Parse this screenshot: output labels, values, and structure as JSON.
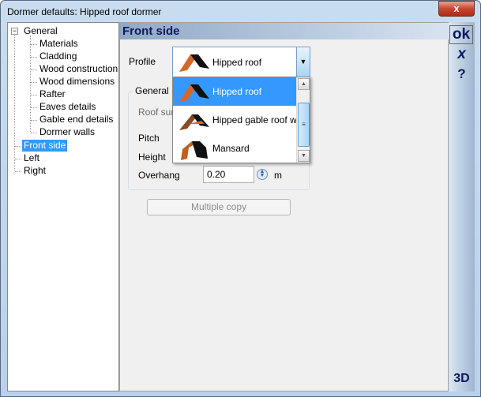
{
  "window": {
    "title": "Dormer defaults: Hipped roof dormer",
    "close": "x"
  },
  "tree": {
    "items": [
      {
        "label": "General",
        "level": 0
      },
      {
        "label": "Materials",
        "level": 1
      },
      {
        "label": "Cladding",
        "level": 1
      },
      {
        "label": "Wood construction",
        "level": 1
      },
      {
        "label": "Wood dimensions",
        "level": 1
      },
      {
        "label": "Rafter",
        "level": 1
      },
      {
        "label": "Eaves details",
        "level": 1
      },
      {
        "label": "Gable end details",
        "level": 1
      },
      {
        "label": "Dormer walls",
        "level": 1
      },
      {
        "label": "Front side",
        "level": 0,
        "selected": true
      },
      {
        "label": "Left",
        "level": 0
      },
      {
        "label": "Right",
        "level": 0
      }
    ]
  },
  "header": {
    "title": "Front side"
  },
  "profile": {
    "label": "Profile",
    "value": "Hipped roof",
    "options": [
      "Hipped roof",
      "Hipped gable roof with",
      "Mansard"
    ],
    "selected_index": 0
  },
  "group": {
    "title": "General",
    "roof_surface": "Roof sur",
    "pitch": "Pitch",
    "height": "Height",
    "overhang": "Overhang",
    "overhang_value": "0.20",
    "unit": "m"
  },
  "buttons": {
    "multiple_copy": "Multiple copy"
  },
  "side": {
    "ok": "ok",
    "cancel": "x",
    "help": "?",
    "view3d": "3D"
  },
  "colors": {
    "accent": "#3399ff",
    "header_text": "#0a1a5e",
    "roof": "#d2692a"
  }
}
